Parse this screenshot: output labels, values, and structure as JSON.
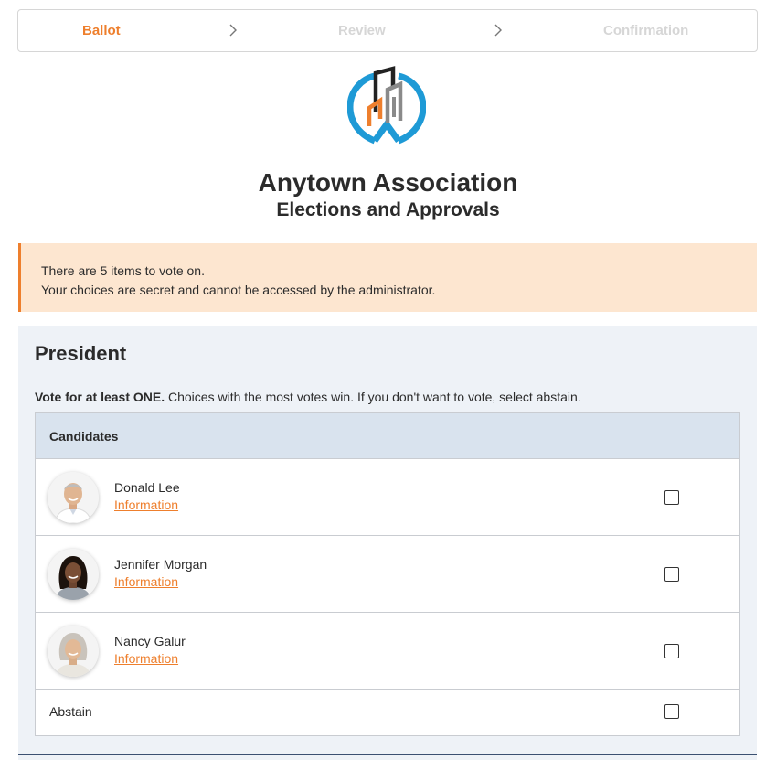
{
  "stepper": {
    "steps": [
      {
        "label": "Ballot",
        "active": true
      },
      {
        "label": "Review",
        "active": false
      },
      {
        "label": "Confirmation",
        "active": false
      }
    ]
  },
  "header": {
    "org_name": "Anytown Association",
    "subtitle": "Elections and Approvals"
  },
  "notice": {
    "line1": "There are 5 items to vote on.",
    "line2": "Your choices are secret and cannot be accessed by the administrator."
  },
  "ballot_item": {
    "title": "President",
    "instructions_bold": "Vote for at least ONE.",
    "instructions_rest": " Choices with the most votes win. If you don't want to vote, select abstain.",
    "table_header": "Candidates",
    "candidates": [
      {
        "name": "Donald Lee",
        "info_link": "Information",
        "checked": false
      },
      {
        "name": "Jennifer Morgan",
        "info_link": "Information",
        "checked": false
      },
      {
        "name": "Nancy Galur",
        "info_link": "Information",
        "checked": false
      }
    ],
    "abstain_label": "Abstain",
    "abstain_checked": false
  },
  "colors": {
    "accent": "#ee7f2d",
    "notice_bg": "#fde6d0",
    "section_bg": "#eef2f7",
    "table_header_bg": "#d9e3ee",
    "logo_blue": "#1e9ad6",
    "logo_dark": "#222222",
    "logo_gray": "#8a8a8a"
  }
}
